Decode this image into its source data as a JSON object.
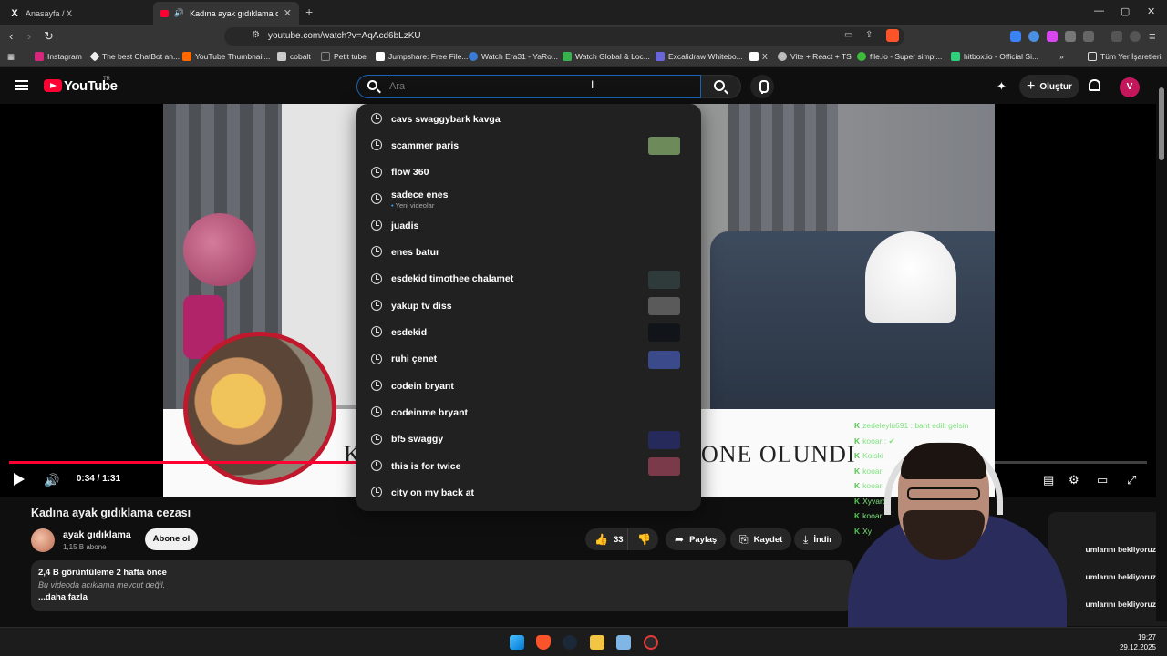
{
  "browser": {
    "tabs": [
      {
        "label": "Anasayfa / X"
      },
      {
        "label": "Kadına ayak gıdıklama cezası"
      }
    ],
    "url": "youtube.com/watch?v=AqAcd6bLzKU",
    "bookmarks": [
      {
        "label": "Instagram",
        "color": "#d6287a"
      },
      {
        "label": "The best ChatBot an...",
        "color": "#eeeeee"
      },
      {
        "label": "YouTube Thumbnail...",
        "color": "#ff6a00"
      },
      {
        "label": "cobalt",
        "color": "#cccccc"
      },
      {
        "label": "Petit tube",
        "color": "#333333"
      },
      {
        "label": "Jumpshare: Free File...",
        "color": "#ffffff"
      },
      {
        "label": "Watch Era31 - YaRo...",
        "color": "#3a7bd5"
      },
      {
        "label": "Watch Global & Loc...",
        "color": "#37b24d"
      },
      {
        "label": "Excalidraw Whitebo...",
        "color": "#6965db"
      },
      {
        "label": "X",
        "color": "#ffffff"
      },
      {
        "label": "Vite + React + TS",
        "color": "#bbbbbb"
      },
      {
        "label": "file.io - Super simpl...",
        "color": "#3dbb3d"
      },
      {
        "label": "hitbox.io - Official Si...",
        "color": "#2fd07a"
      }
    ],
    "all_bookmarks": "Tüm Yer İşaretleri"
  },
  "youtube": {
    "logo_text": "YouTube",
    "region": "TR",
    "search_placeholder": "Ara",
    "create_label": "Oluştur",
    "avatar_letter": "V"
  },
  "suggestions": [
    {
      "text": "cavs swaggybark kavga",
      "thumb": null
    },
    {
      "text": "scammer paris",
      "thumb": "#6d8a5a"
    },
    {
      "text": "flow 360",
      "thumb": null
    },
    {
      "text": "sadece enes",
      "sub": "Yeni videolar",
      "thumb": null
    },
    {
      "text": "juadis",
      "thumb": null
    },
    {
      "text": "enes batur",
      "thumb": null
    },
    {
      "text": "esdekid timothee chalamet",
      "thumb": "#2f3b3a"
    },
    {
      "text": "yakup tv diss",
      "thumb": "#5a5a5a"
    },
    {
      "text": "esdekid",
      "thumb": "#111418"
    },
    {
      "text": "ruhi çenet",
      "thumb": "#3a4a8a"
    },
    {
      "text": "codein bryant",
      "thumb": null
    },
    {
      "text": "codeinme bryant",
      "thumb": null
    },
    {
      "text": "bf5 swaggy",
      "thumb": "#262a5a"
    },
    {
      "text": "this is for twice",
      "thumb": "#7a3a4a"
    },
    {
      "text": "city on my back at",
      "thumb": null
    }
  ],
  "player": {
    "time": "0:34 / 1:31",
    "progress": 0.374,
    "banner_text": "ONE OLUNDI",
    "banner_k": "K"
  },
  "chat": [
    "zedeleylu691 : bant edilt gelsin",
    "kooar : ✔",
    "Kolski",
    "kooar",
    "kooar",
    "Xyvaron",
    "kooar",
    "Xy"
  ],
  "video": {
    "title": "Kadına ayak gıdıklama cezası",
    "channel": "ayak gıdıklama",
    "subscribers": "1,15 B abone",
    "subscribe_label": "Abone ol",
    "likes": "33",
    "share_label": "Paylaş",
    "save_label": "Kaydet",
    "download_label": "İndir",
    "views_line": "2,4 B görüntüleme  2 hafta önce",
    "description": "Bu videoda açıklama mevcut değil.",
    "more_label": "...daha fazla"
  },
  "waiting": [
    "umlarını bekliyoruz",
    "umlarını bekliyoruz",
    "umlarını bekliyoruz"
  ],
  "taskbar": {
    "time": "19:27",
    "date": "29.12.2025"
  }
}
